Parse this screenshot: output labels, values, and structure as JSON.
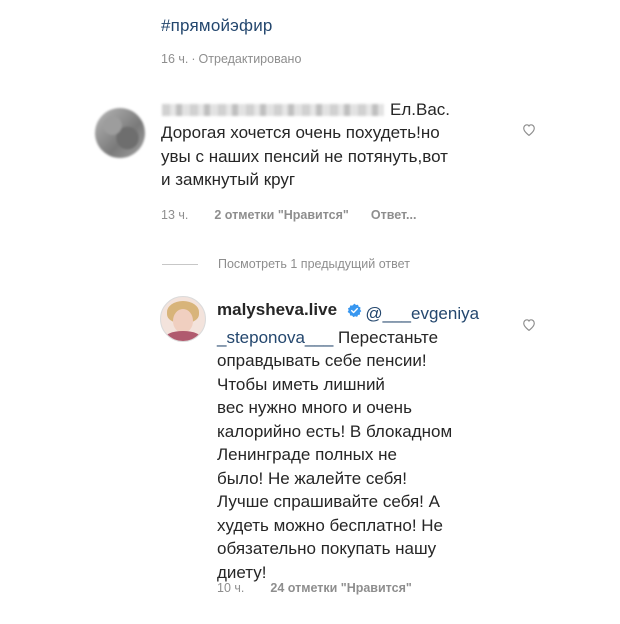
{
  "post": {
    "hashtag": "#прямойэфир",
    "time": "16 ч.",
    "dot": "·",
    "edited": "Отредактировано"
  },
  "comment1": {
    "name_tail": "Ел.Вас.",
    "text": "Дорогая хочется очень похудеть!но\nувы с наших пенсий не потянуть,вот\nи замкнутый круг",
    "time": "13 ч.",
    "likes": "2 отметки \"Нравится\"",
    "reply": "Ответ..."
  },
  "view_previous": "Посмотреть 1 предыдущий ответ",
  "comment2": {
    "username": "malysheva.live",
    "mention_part1": "@___evgeniya",
    "mention_part2": "_steponova___",
    "text_after_mention": " Перестаньте\nоправдывать себе пенсии!\nЧтобы иметь лишний\nвес нужно много и очень\nкалорийно есть! В блокадном\nЛенинграде полных не\nбыло! Не жалейте себя!\nЛучше спрашивайте себя! А\nхудеть можно бесплатно! Не\nобязательно покупать нашу\nдиету!",
    "time": "10 ч.",
    "likes": "24 отметки \"Нравится\""
  },
  "icons": {
    "heart": "heart-icon",
    "verified": "verified-badge-icon",
    "verified_color": "#3897f0"
  },
  "colors": {
    "hashtag": "#24476e",
    "meta": "#8e8e8e",
    "text": "#262626"
  }
}
